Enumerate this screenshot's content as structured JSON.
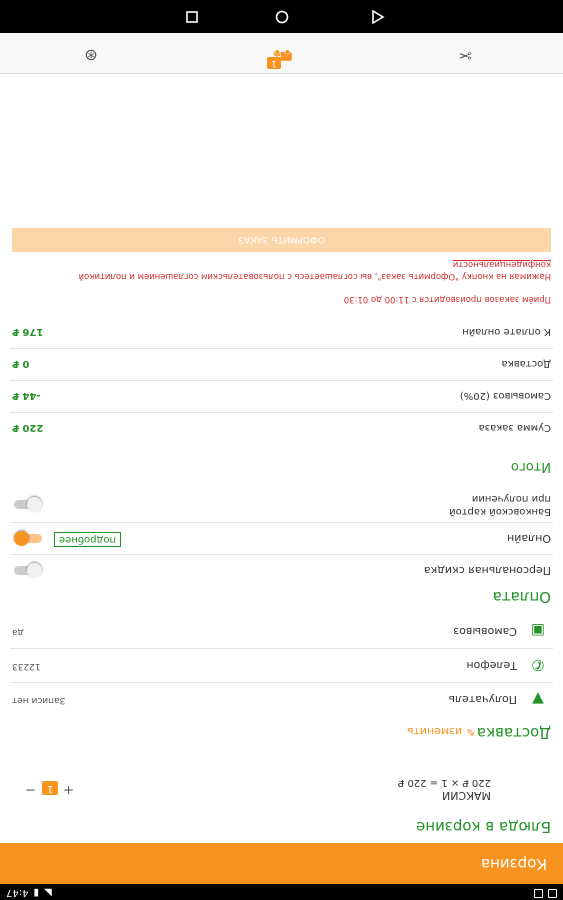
{
  "status": {
    "time": "4:47"
  },
  "appbar": {
    "title": "Корзина"
  },
  "cart": {
    "title": "Блюда в корзине",
    "item": {
      "name": "МАКСИИ",
      "price_line": "220 ₽ × 1 = 220 ₽",
      "qty": "1",
      "minus": "−",
      "plus": "+"
    }
  },
  "delivery": {
    "title": "Доставка",
    "change_label": "изменить",
    "recipient_label": "Получатель",
    "recipient_value": "Записи нет",
    "phone_label": "Телефон",
    "phone_value": "12233",
    "method_label": "Самовывоз",
    "method_value": "да"
  },
  "payment": {
    "title": "Оплата",
    "personal_discount_label": "Персональная скидка",
    "personal_discount_on": false,
    "online_label": "Онлайн",
    "online_more": "подробнее",
    "online_on": true,
    "card_label_1": "Банковской картой",
    "card_label_2": "при получении",
    "card_on": false
  },
  "totals": {
    "title": "Итого",
    "sum_label": "Сумма заказа",
    "sum_value": "220 ₽",
    "pickup_label": "Самовывоз (20%)",
    "pickup_value": "-44 ₽",
    "delivery_label": "Доставка",
    "delivery_value": "0 ₽",
    "online_label": "К оплате онлайн",
    "online_value": "176 ₽"
  },
  "notes": {
    "hours": "Приём заказов производится с 11:00 до 01:30",
    "consent_1": "Нажимая на кнопку \"Оформить заказ\", вы соглашаетесь с пользовательским соглашением и политикой",
    "consent_2": "конфиденциальности"
  },
  "submit": {
    "label": "ОФОРМИТЬ ЗАКАЗ"
  },
  "bottomnav": {
    "badge": "1",
    "icons": [
      "cutlery-icon",
      "cart-icon",
      "support-icon"
    ]
  },
  "colors": {
    "accent": "#f7931e",
    "green": "#249228",
    "disabled_button": "#fbd6a8"
  }
}
